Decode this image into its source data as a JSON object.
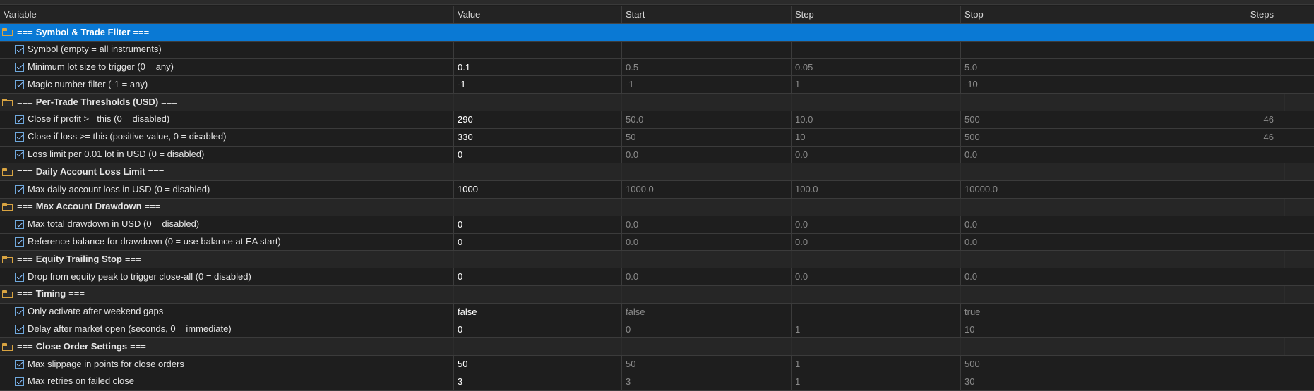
{
  "columns": {
    "variable": "Variable",
    "value": "Value",
    "start": "Start",
    "step": "Step",
    "stop": "Stop",
    "steps": "Steps"
  },
  "group_prefix": "===",
  "group_suffix": "===",
  "accent_color": "#0a79d4",
  "rows": [
    {
      "kind": "group",
      "label": "Symbol & Trade Filter",
      "selected": true
    },
    {
      "kind": "param",
      "label": "Symbol (empty = all instruments)",
      "value": "",
      "start": "",
      "step": "",
      "stop": "",
      "steps": ""
    },
    {
      "kind": "param",
      "label": "Minimum lot size to trigger (0 = any)",
      "value": "0.1",
      "start": "0.5",
      "step": "0.05",
      "stop": "5.0",
      "steps": ""
    },
    {
      "kind": "param",
      "label": "Magic number filter (-1 = any)",
      "value": "-1",
      "start": "-1",
      "step": "1",
      "stop": "-10",
      "steps": ""
    },
    {
      "kind": "group",
      "label": "Per-Trade Thresholds (USD)"
    },
    {
      "kind": "param",
      "label": "Close if profit >= this (0 = disabled)",
      "value": "290",
      "start": "50.0",
      "step": "10.0",
      "stop": "500",
      "steps": "46"
    },
    {
      "kind": "param",
      "label": "Close if loss >= this (positive value, 0 = disabled)",
      "value": "330",
      "start": "50",
      "step": "10",
      "stop": "500",
      "steps": "46"
    },
    {
      "kind": "param",
      "label": "Loss limit per 0.01 lot in USD (0 = disabled)",
      "value": "0",
      "start": "0.0",
      "step": "0.0",
      "stop": "0.0",
      "steps": ""
    },
    {
      "kind": "group",
      "label": "Daily Account Loss Limit"
    },
    {
      "kind": "param",
      "label": "Max daily account loss in USD (0 = disabled)",
      "value": "1000",
      "start": "1000.0",
      "step": "100.0",
      "stop": "10000.0",
      "steps": ""
    },
    {
      "kind": "group",
      "label": "Max Account Drawdown"
    },
    {
      "kind": "param",
      "label": "Max total drawdown in USD (0 = disabled)",
      "value": "0",
      "start": "0.0",
      "step": "0.0",
      "stop": "0.0",
      "steps": ""
    },
    {
      "kind": "param",
      "label": "Reference balance for drawdown (0 = use balance at EA start)",
      "value": "0",
      "start": "0.0",
      "step": "0.0",
      "stop": "0.0",
      "steps": ""
    },
    {
      "kind": "group",
      "label": "Equity Trailing Stop"
    },
    {
      "kind": "param",
      "label": "Drop from equity peak to trigger close-all (0 = disabled)",
      "value": "0",
      "start": "0.0",
      "step": "0.0",
      "stop": "0.0",
      "steps": ""
    },
    {
      "kind": "group",
      "label": "Timing"
    },
    {
      "kind": "param",
      "label": "Only activate after weekend gaps",
      "value": "false",
      "start": "false",
      "step": "",
      "stop": "true",
      "steps": ""
    },
    {
      "kind": "param",
      "label": "Delay after market open (seconds, 0 = immediate)",
      "value": "0",
      "start": "0",
      "step": "1",
      "stop": "10",
      "steps": ""
    },
    {
      "kind": "group",
      "label": "Close Order Settings"
    },
    {
      "kind": "param",
      "label": "Max slippage in points for close orders",
      "value": "50",
      "start": "50",
      "step": "1",
      "stop": "500",
      "steps": ""
    },
    {
      "kind": "param",
      "label": "Max retries on failed close",
      "value": "3",
      "start": "3",
      "step": "1",
      "stop": "30",
      "steps": ""
    }
  ]
}
